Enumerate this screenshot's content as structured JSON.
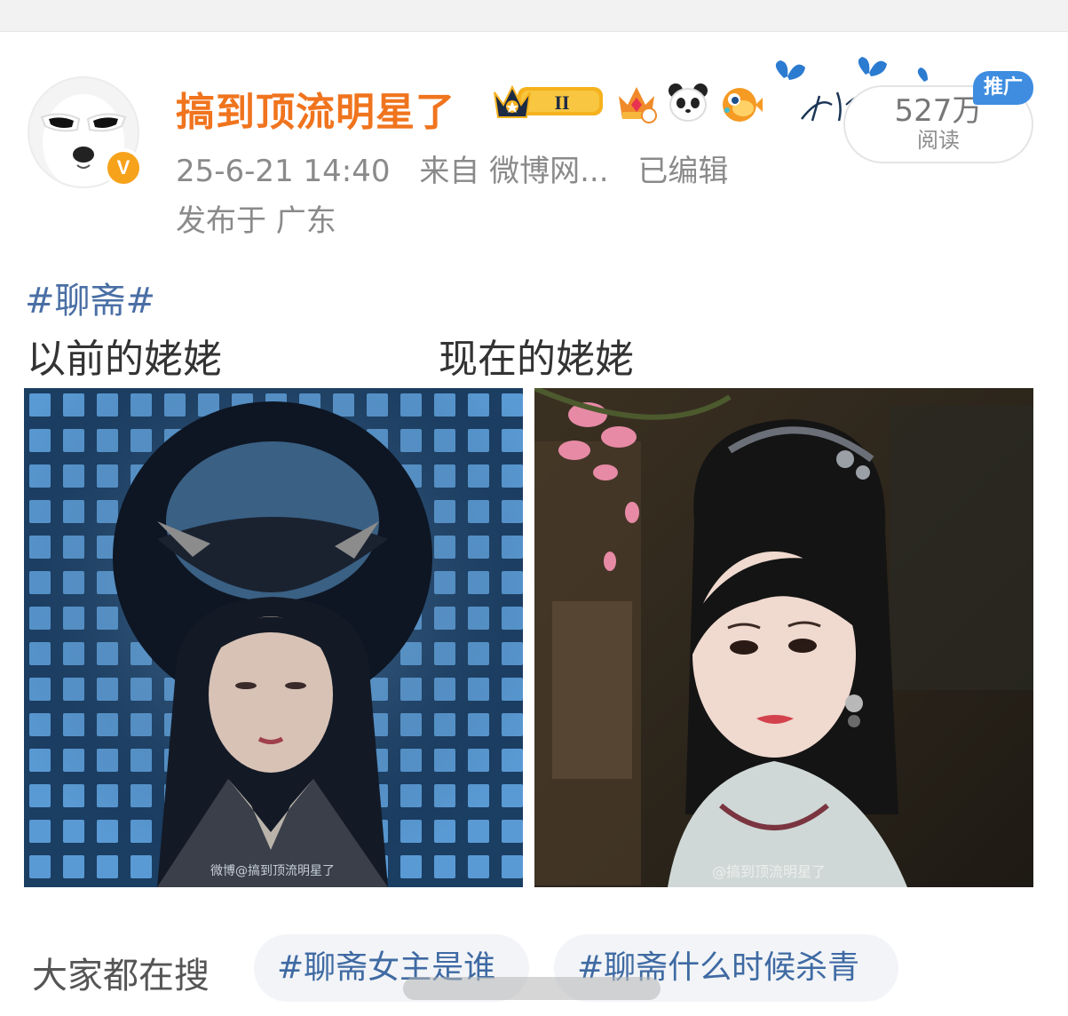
{
  "post": {
    "author": {
      "name": "搞到顶流明星了",
      "verified_badge": "V",
      "badge_icons": [
        "crown-level-2-badge",
        "gem-crown-badge",
        "panda-badge",
        "pufferfish-badge",
        "butterfly-signature-badge"
      ],
      "badge_level": "II"
    },
    "meta": {
      "timestamp": "25-6-21 14:40",
      "source": "来自 微博网...",
      "edited": "已编辑",
      "location": "发布于 广东"
    },
    "read_count": {
      "value": "527万",
      "label": "阅读"
    },
    "ad_tag": "推广",
    "hashtag": "#聊斋#",
    "caption_left": "以前的姥姥",
    "caption_right": "现在的姥姥",
    "images": [
      {
        "watermark": "微博@搞到顶流明星了"
      },
      {
        "watermark": "@搞到顶流明星了"
      }
    ]
  },
  "trending": {
    "label": "大家都在搜",
    "chips": [
      "#聊斋女主是谁",
      "#聊斋什么时候杀青"
    ]
  },
  "colors": {
    "username": "#f0741e",
    "hashtag": "#4a6fa5",
    "ad_tag": "#3f8de0",
    "verified": "#f7a21b"
  }
}
